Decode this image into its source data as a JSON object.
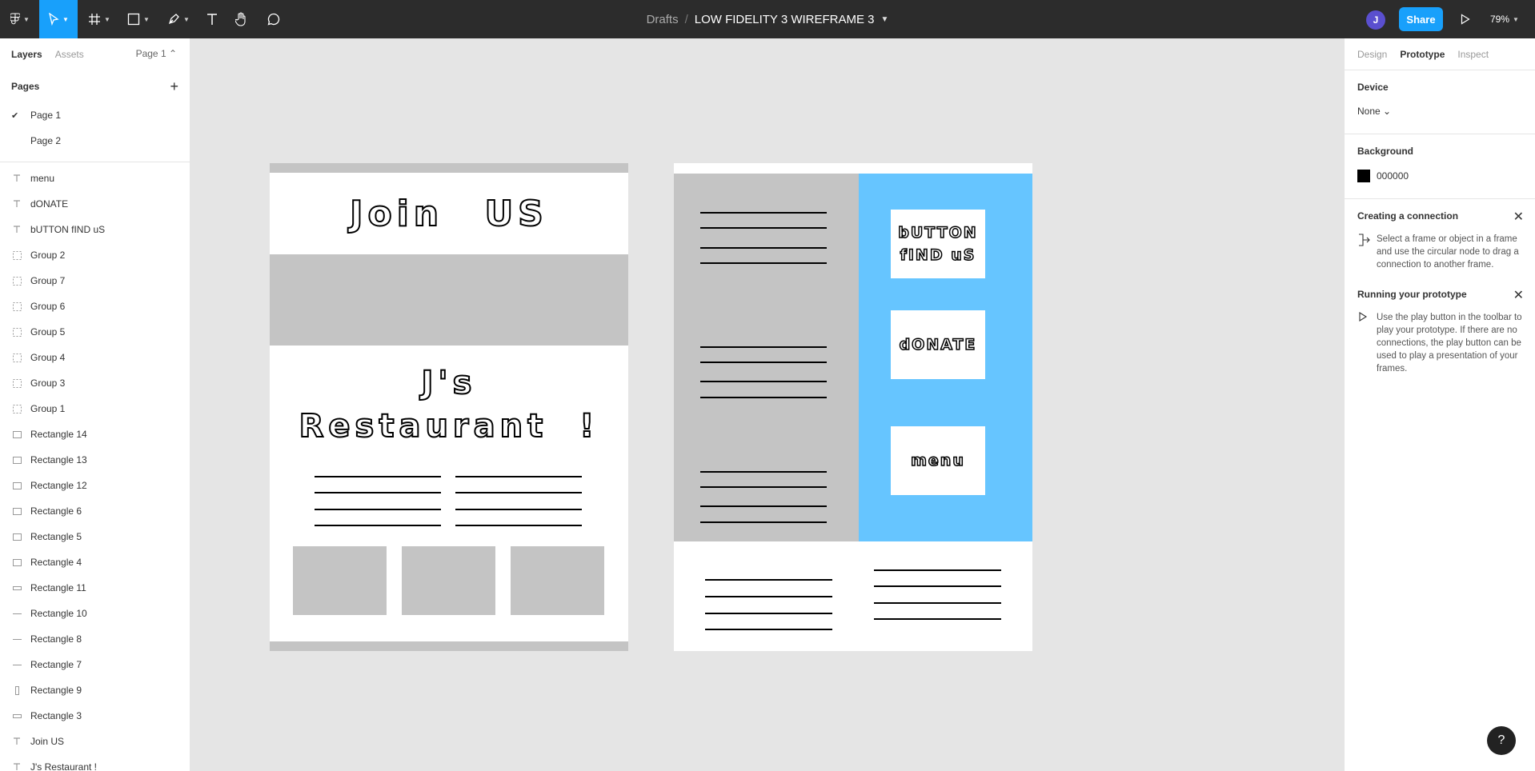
{
  "toolbar": {
    "breadcrumb_root": "Drafts",
    "separator": "/",
    "file_name": "LOW FIDELITY 3 WIREFRAME 3",
    "avatar_initial": "J",
    "share_label": "Share",
    "zoom": "79%"
  },
  "left_panel": {
    "tabs": [
      "Layers",
      "Assets"
    ],
    "page_selector": "Page 1 ⌃",
    "pages_header": "Pages",
    "pages": [
      {
        "label": "Page 1",
        "checked": true
      },
      {
        "label": "Page 2",
        "checked": false
      }
    ],
    "layers": [
      {
        "label": "menu",
        "icon": "text-icon"
      },
      {
        "label": "dONATE",
        "icon": "text-icon"
      },
      {
        "label": "bUTTON fIND uS",
        "icon": "text-icon"
      },
      {
        "label": "Group 2",
        "icon": "group-icon"
      },
      {
        "label": "Group 7",
        "icon": "group-icon"
      },
      {
        "label": "Group 6",
        "icon": "group-icon"
      },
      {
        "label": "Group 5",
        "icon": "group-icon"
      },
      {
        "label": "Group 4",
        "icon": "group-icon"
      },
      {
        "label": "Group 3",
        "icon": "group-icon"
      },
      {
        "label": "Group 1",
        "icon": "group-icon"
      },
      {
        "label": "Rectangle 14",
        "icon": "rectangle-icon"
      },
      {
        "label": "Rectangle 13",
        "icon": "rectangle-icon"
      },
      {
        "label": "Rectangle 12",
        "icon": "rectangle-icon"
      },
      {
        "label": "Rectangle 6",
        "icon": "rectangle-icon"
      },
      {
        "label": "Rectangle 5",
        "icon": "rectangle-icon"
      },
      {
        "label": "Rectangle 4",
        "icon": "rectangle-icon"
      },
      {
        "label": "Rectangle 11",
        "icon": "wide-rectangle-icon"
      },
      {
        "label": "Rectangle 10",
        "icon": "line-icon"
      },
      {
        "label": "Rectangle 8",
        "icon": "line-icon"
      },
      {
        "label": "Rectangle 7",
        "icon": "line-icon"
      },
      {
        "label": "Rectangle 9",
        "icon": "tall-rectangle-icon"
      },
      {
        "label": "Rectangle 3",
        "icon": "wide-rectangle-icon"
      },
      {
        "label": "Join US",
        "icon": "text-icon"
      },
      {
        "label": "J's Restaurant !",
        "icon": "text-icon"
      }
    ]
  },
  "right_panel": {
    "tabs": [
      "Design",
      "Prototype",
      "Inspect"
    ],
    "active_tab": "Prototype",
    "device_header": "Device",
    "device_value": "None ⌄",
    "background_header": "Background",
    "background_value": "000000",
    "background_color": "#000000",
    "connection_header": "Creating a connection",
    "connection_text": "Select a frame or object in a frame and use the circular node to drag a connection to another frame.",
    "running_header": "Running your prototype",
    "running_text": "Use the play button in the toolbar to play your prototype. If there are no connections, the play button can be used to play a presentation of your frames."
  },
  "canvas": {
    "frame1": {
      "heading": "Join US",
      "title_line1": "J's",
      "title_line2": "Restaurant !"
    },
    "frame2": {
      "button_find_us": "bUTTON fIND uS",
      "donate": "dONATE",
      "menu": "menu",
      "accent_color": "#66c5ff"
    }
  },
  "colors": {
    "toolbar": "#2c2c2c",
    "accent": "#18a0fb",
    "placeholder_gray": "#c4c4c4",
    "canvas": "#e5e5e5"
  }
}
